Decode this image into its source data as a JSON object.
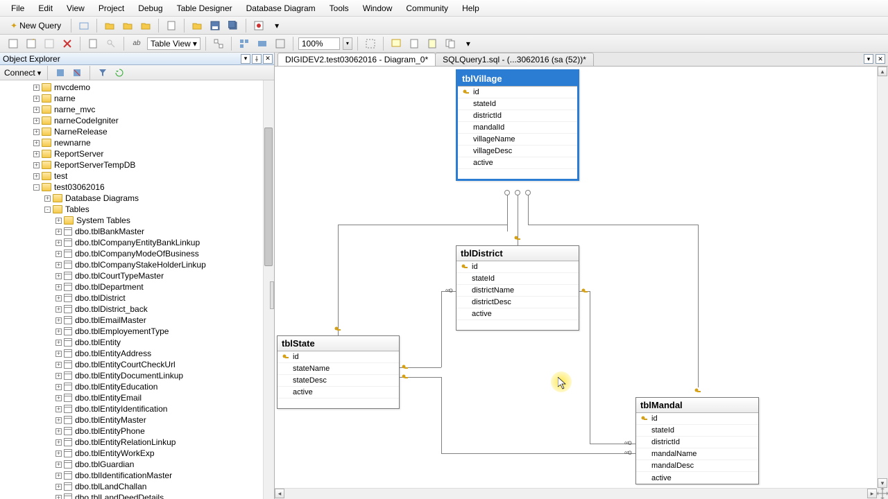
{
  "menu": [
    "File",
    "Edit",
    "View",
    "Project",
    "Debug",
    "Table Designer",
    "Database Diagram",
    "Tools",
    "Window",
    "Community",
    "Help"
  ],
  "toolbar1": {
    "newQuery": "New Query"
  },
  "toolbar2": {
    "tableView": "Table View",
    "zoom": "100%"
  },
  "explorer": {
    "title": "Object Explorer",
    "connect": "Connect",
    "tree": {
      "dbs": [
        {
          "lv": 0,
          "exp": "+",
          "icon": "folder",
          "label": "mvcdemo"
        },
        {
          "lv": 0,
          "exp": "+",
          "icon": "folder",
          "label": "narne"
        },
        {
          "lv": 0,
          "exp": "+",
          "icon": "folder",
          "label": "narne_mvc"
        },
        {
          "lv": 0,
          "exp": "+",
          "icon": "folder",
          "label": "narneCodeIgniter"
        },
        {
          "lv": 0,
          "exp": "+",
          "icon": "folder",
          "label": "NarneRelease"
        },
        {
          "lv": 0,
          "exp": "+",
          "icon": "folder",
          "label": "newnarne"
        },
        {
          "lv": 0,
          "exp": "+",
          "icon": "folder",
          "label": "ReportServer"
        },
        {
          "lv": 0,
          "exp": "+",
          "icon": "folder",
          "label": "ReportServerTempDB"
        },
        {
          "lv": 0,
          "exp": "+",
          "icon": "folder",
          "label": "test"
        },
        {
          "lv": 0,
          "exp": "-",
          "icon": "folder",
          "label": "test03062016"
        },
        {
          "lv": 1,
          "exp": "+",
          "icon": "folder",
          "label": "Database Diagrams"
        },
        {
          "lv": 1,
          "exp": "-",
          "icon": "folder",
          "label": "Tables"
        },
        {
          "lv": 2,
          "exp": "+",
          "icon": "folder",
          "label": "System Tables"
        },
        {
          "lv": 2,
          "exp": "+",
          "icon": "table",
          "label": "dbo.tblBankMaster"
        },
        {
          "lv": 2,
          "exp": "+",
          "icon": "table",
          "label": "dbo.tblCompanyEntityBankLinkup"
        },
        {
          "lv": 2,
          "exp": "+",
          "icon": "table",
          "label": "dbo.tblCompanyModeOfBusiness"
        },
        {
          "lv": 2,
          "exp": "+",
          "icon": "table",
          "label": "dbo.tblCompanyStakeHolderLinkup"
        },
        {
          "lv": 2,
          "exp": "+",
          "icon": "table",
          "label": "dbo.tblCourtTypeMaster"
        },
        {
          "lv": 2,
          "exp": "+",
          "icon": "table",
          "label": "dbo.tblDepartment"
        },
        {
          "lv": 2,
          "exp": "+",
          "icon": "table",
          "label": "dbo.tblDistrict"
        },
        {
          "lv": 2,
          "exp": "+",
          "icon": "table",
          "label": "dbo.tblDistrict_back"
        },
        {
          "lv": 2,
          "exp": "+",
          "icon": "table",
          "label": "dbo.tblEmailMaster"
        },
        {
          "lv": 2,
          "exp": "+",
          "icon": "table",
          "label": "dbo.tblEmployementType"
        },
        {
          "lv": 2,
          "exp": "+",
          "icon": "table",
          "label": "dbo.tblEntity"
        },
        {
          "lv": 2,
          "exp": "+",
          "icon": "table",
          "label": "dbo.tblEntityAddress"
        },
        {
          "lv": 2,
          "exp": "+",
          "icon": "table",
          "label": "dbo.tblEntityCourtCheckUrl"
        },
        {
          "lv": 2,
          "exp": "+",
          "icon": "table",
          "label": "dbo.tblEntityDocumentLinkup"
        },
        {
          "lv": 2,
          "exp": "+",
          "icon": "table",
          "label": "dbo.tblEntityEducation"
        },
        {
          "lv": 2,
          "exp": "+",
          "icon": "table",
          "label": "dbo.tblEntityEmail"
        },
        {
          "lv": 2,
          "exp": "+",
          "icon": "table",
          "label": "dbo.tblEntityIdentification"
        },
        {
          "lv": 2,
          "exp": "+",
          "icon": "table",
          "label": "dbo.tblEntityMaster"
        },
        {
          "lv": 2,
          "exp": "+",
          "icon": "table",
          "label": "dbo.tblEntityPhone"
        },
        {
          "lv": 2,
          "exp": "+",
          "icon": "table",
          "label": "dbo.tblEntityRelationLinkup"
        },
        {
          "lv": 2,
          "exp": "+",
          "icon": "table",
          "label": "dbo.tblEntityWorkExp"
        },
        {
          "lv": 2,
          "exp": "+",
          "icon": "table",
          "label": "dbo.tblGuardian"
        },
        {
          "lv": 2,
          "exp": "+",
          "icon": "table",
          "label": "dbo.tblIdentificationMaster"
        },
        {
          "lv": 2,
          "exp": "+",
          "icon": "table",
          "label": "dbo.tblLandChallan"
        },
        {
          "lv": 2,
          "exp": "+",
          "icon": "table",
          "label": "dbo.tblLandDeedDetails"
        }
      ]
    }
  },
  "tabs": [
    {
      "label": "DIGIDEV2.test03062016 - Diagram_0*",
      "active": true
    },
    {
      "label": "SQLQuery1.sql - (...3062016 (sa (52))*",
      "active": false
    }
  ],
  "diagram": {
    "village": {
      "title": "tblVillage",
      "cols": [
        {
          "k": true,
          "n": "id"
        },
        {
          "k": false,
          "n": "stateId"
        },
        {
          "k": false,
          "n": "districtId"
        },
        {
          "k": false,
          "n": "mandalId"
        },
        {
          "k": false,
          "n": "villageName"
        },
        {
          "k": false,
          "n": "villageDesc"
        },
        {
          "k": false,
          "n": "active"
        }
      ]
    },
    "district": {
      "title": "tblDistrict",
      "cols": [
        {
          "k": true,
          "n": "id"
        },
        {
          "k": false,
          "n": "stateId"
        },
        {
          "k": false,
          "n": "districtName"
        },
        {
          "k": false,
          "n": "districtDesc"
        },
        {
          "k": false,
          "n": "active"
        }
      ]
    },
    "state": {
      "title": "tblState",
      "cols": [
        {
          "k": true,
          "n": "id"
        },
        {
          "k": false,
          "n": "stateName"
        },
        {
          "k": false,
          "n": "stateDesc"
        },
        {
          "k": false,
          "n": "active"
        }
      ]
    },
    "mandal": {
      "title": "tblMandal",
      "cols": [
        {
          "k": true,
          "n": "id"
        },
        {
          "k": false,
          "n": "stateId"
        },
        {
          "k": false,
          "n": "districtId"
        },
        {
          "k": false,
          "n": "mandalName"
        },
        {
          "k": false,
          "n": "mandalDesc"
        },
        {
          "k": false,
          "n": "active"
        }
      ]
    }
  }
}
